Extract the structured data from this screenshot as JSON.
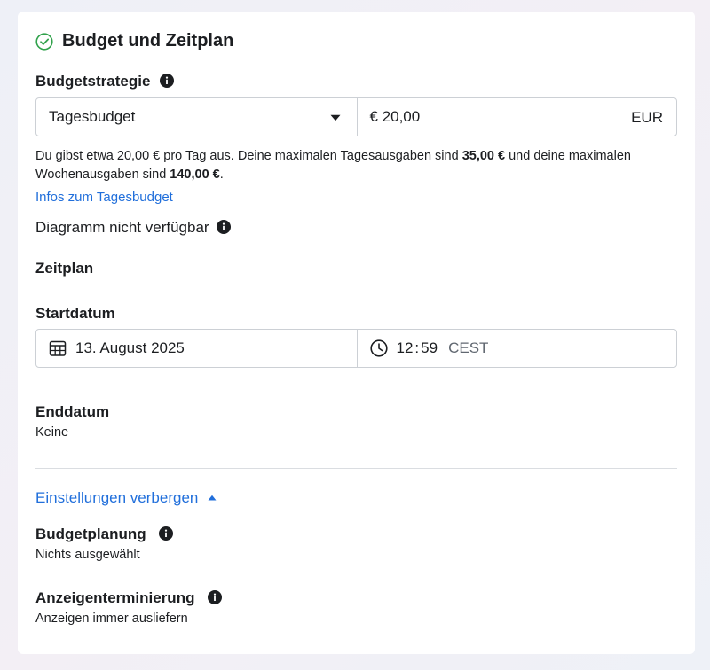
{
  "section": {
    "title": "Budget und Zeitplan",
    "check_icon": "check-circle-icon"
  },
  "budget": {
    "strategy_label": "Budgetstrategie",
    "strategy_value": "Tagesbudget",
    "amount": "€ 20,00",
    "currency": "EUR",
    "desc_part1": "Du gibst etwa 20,00 € pro Tag aus. Deine maximalen Tagesausgaben sind ",
    "desc_max_daily": "35,00 €",
    "desc_part2": " und deine maximalen Wochenausgaben sind ",
    "desc_max_weekly": "140,00 €",
    "desc_part3": ".",
    "info_link": "Infos zum Tagesbudget",
    "chart_unavailable": "Diagramm nicht verfügbar"
  },
  "schedule": {
    "heading": "Zeitplan",
    "start_label": "Startdatum",
    "start_date": "13. August 2025",
    "start_hour": "12",
    "start_sep": ":",
    "start_minute": "59",
    "timezone": "CEST",
    "end_label": "Enddatum",
    "end_value": "Keine"
  },
  "settings": {
    "toggle_label": "Einstellungen verbergen",
    "budget_planning_label": "Budgetplanung",
    "budget_planning_value": "Nichts ausgewählt",
    "ad_scheduling_label": "Anzeigenterminierung",
    "ad_scheduling_value": "Anzeigen immer ausliefern"
  },
  "colors": {
    "link": "#216fdb",
    "success": "#31a24c",
    "border": "#ccd0d5"
  }
}
